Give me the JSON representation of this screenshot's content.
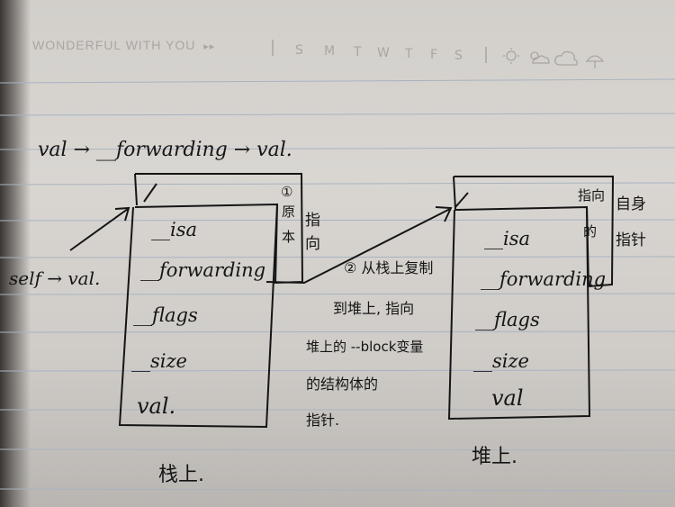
{
  "header": {
    "brand": "WONDERFUL WITH YOU",
    "brand_arrows": "▸▸",
    "days": [
      "S",
      "M",
      "T",
      "W",
      "T",
      "F",
      "S"
    ],
    "weather_icons": [
      "sun-icon",
      "partly-cloudy-icon",
      "cloud-icon",
      "umbrella-icon"
    ]
  },
  "diagram": {
    "top_note": "val → __forwarding → val.",
    "self_label": "self → val.",
    "stack_box": {
      "fields": [
        "__isa",
        "__forwarding",
        "__flags",
        "__size",
        "val."
      ],
      "side_note_num": "①",
      "side_note_a": "原",
      "side_note_b": "本",
      "pointer_note_a": "指",
      "pointer_note_b": "向",
      "caption": "栈上."
    },
    "heap_box": {
      "fields": [
        "__isa",
        "__forwarding",
        "__flags",
        "__size",
        "val"
      ],
      "pointer_note": "指向自身的指针",
      "pointer_note_lines": [
        "指向",
        "自身",
        "的",
        "指针"
      ],
      "caption": "堆上."
    },
    "middle_note_lines": [
      "② 从栈上复制",
      "到堆上, 指向",
      "堆上的 --block变量",
      "的结构体的",
      "指针."
    ]
  }
}
